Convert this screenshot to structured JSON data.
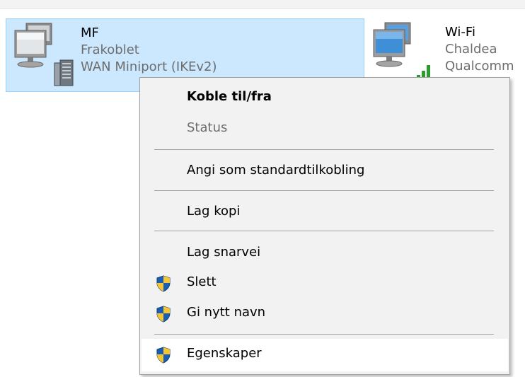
{
  "connections": [
    {
      "name": "MF",
      "status": "Frakoblet",
      "device": "WAN Miniport (IKEv2)",
      "icon": "wired-network-computer-icon",
      "selected": true
    },
    {
      "name": "Wi-Fi",
      "status": "Chaldea",
      "device": "Qualcomm",
      "icon": "wifi-network-computer-icon",
      "selected": false
    }
  ],
  "context_menu": {
    "items": [
      {
        "label": "Koble til/fra",
        "bold": true,
        "disabled": false,
        "icon": null
      },
      {
        "label": "Status",
        "bold": false,
        "disabled": true,
        "icon": null
      },
      {
        "label": "Angi som standardtilkobling",
        "bold": false,
        "disabled": false,
        "icon": null
      },
      {
        "label": "Lag kopi",
        "bold": false,
        "disabled": false,
        "icon": null
      },
      {
        "label": "Lag snarvei",
        "bold": false,
        "disabled": false,
        "icon": null
      },
      {
        "label": "Slett",
        "bold": false,
        "disabled": false,
        "icon": "uac-shield-icon"
      },
      {
        "label": "Gi nytt navn",
        "bold": false,
        "disabled": false,
        "icon": "uac-shield-icon"
      },
      {
        "label": "Egenskaper",
        "bold": false,
        "disabled": false,
        "icon": "uac-shield-icon",
        "highlighted": true
      }
    ]
  },
  "colors": {
    "selection_background": "#cce8ff",
    "selection_border": "#99d1ff",
    "menu_background": "#f2f2f2",
    "menu_highlight": "#ffffff",
    "secondary_text": "#6d6d6d",
    "shield_blue": "#1a5fb4",
    "shield_yellow": "#f6c533",
    "signal_green": "#2e9b2e"
  }
}
